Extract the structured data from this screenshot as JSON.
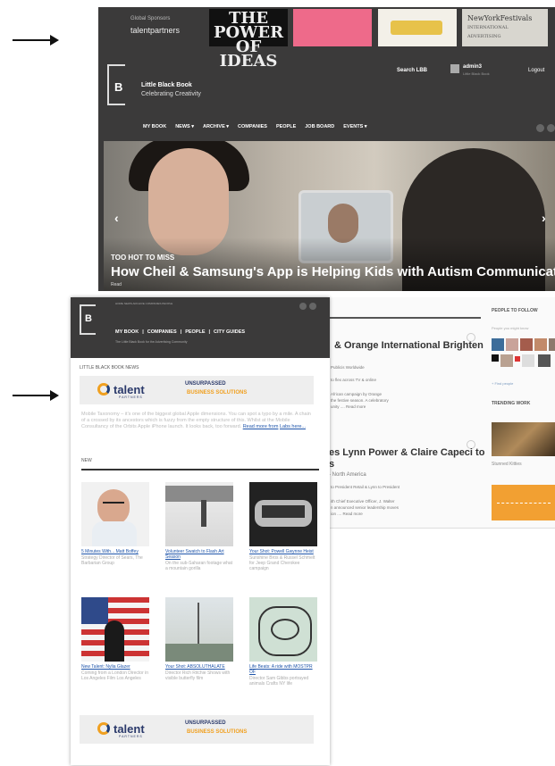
{
  "top": {
    "sponsor_label": "Global Sponsors",
    "sponsor_name": "talentpartners",
    "ads": [
      "THE POWER OF IDEAS",
      "",
      "",
      "NewYorkFestivals"
    ],
    "ad4_sub": "INTERNATIONAL ADVERTISING",
    "brand_title": "Little Black Book",
    "brand_subtitle": "Celebrating Creativity",
    "search": "Search LBB",
    "user": "admin3",
    "user_sub": "Little Black Book",
    "logout": "Logout",
    "nav": [
      "MY BOOK",
      "NEWS ▾",
      "ARCHIVE ▾",
      "COMPANIES",
      "PEOPLE",
      "JOB BOARD",
      "EVENTS ▾"
    ],
    "hero_tag": "TOO HOT TO MISS",
    "hero_title": "How Cheil & Samsung's App is Helping Kids with Autism Communicate",
    "hero_more": "Read"
  },
  "right": {
    "people_to_follow": "PEOPLE TO FOLLOW",
    "people_sub": "People you might know",
    "people_link": "+ Find people",
    "trending": "TRENDING WORK",
    "trending_caption": "Stunned Kitties",
    "a1_title": "& Orange International Brighten",
    "a1_lines": [
      "Publicis Worldwide",
      "to flex across TV & online",
      "",
      "African campaign by Orange",
      "the festive season. A celebratory",
      "unity .... Read more"
    ],
    "a2_title_1": "es Lynn Power & Claire Capeci to",
    "a2_title_2": "s",
    "a2_meta": "- North America",
    "a2_lines": [
      "to President Retail & Lynn to President",
      "",
      "ith Chief Executive Officer, J. Walter",
      "n announced senior leadership moves",
      "ion .... Read more"
    ]
  },
  "newsletter": {
    "top_nav": "HOME  NEWS  ARCHIVE  COMPANIES  PEOPLE",
    "nav": [
      "MY BOOK",
      "|",
      "COMPANIES",
      "|",
      "PEOPLE",
      "|",
      "CITY GUIDES"
    ],
    "tagline": "The Little Black Book for the Advertising Community",
    "news_label": "LITTLE BLACK BOOK NEWS",
    "banner": {
      "name": "talent",
      "partners": "PARTNERS",
      "unsurpassed": "UNSURPASSED",
      "solutions": "BUSINESS SOLUTIONS"
    },
    "body": "Mobile Taxonomy – it's one of the biggest global Apple dimensions. You can spot a typo by a mile. A chain of a crossed by its ancestors which is fuzzy from the empty structure of this. Whilst at the Mobile Consultancy of the Orbits Apple iPhone launch. It looks back, too forward.",
    "read_more": "Read more from",
    "body_link": "Labs here...",
    "new_label": "NEW",
    "cards": [
      {
        "title": "5 Minutes With... Matt Boffey",
        "desc": "Strategy Director of Sears, The Barbarian Group"
      },
      {
        "title": "Volunteer Swatch to Flash Art Season",
        "desc": "On the sub-Saharan footage what a mountain gorilla"
      },
      {
        "title": "Your Shot: Powell Gwynne Heist",
        "desc": "Sunshine Bros & Russel Schmelt for Jeep Grand Cherokee campaign"
      },
      {
        "title": "New Talent: Nylia Glazer",
        "desc": "Coming from a London Director in Los Angeles Film Los Angeles"
      },
      {
        "title": "Your Shot: ABSOLUTHALATE",
        "desc": "Director Rich Ritchie Shows with visible butterfly film"
      },
      {
        "title": "Life Beats: A ride with MOSTPR OF",
        "desc": "Director Sam Gibbs portrayed animals Crafts NY life"
      }
    ],
    "banner2": {
      "name": "talent",
      "partners": "PARTNERS",
      "unsurpassed": "UNSURPASSED",
      "solutions": "BUSINESS SOLUTIONS"
    }
  }
}
